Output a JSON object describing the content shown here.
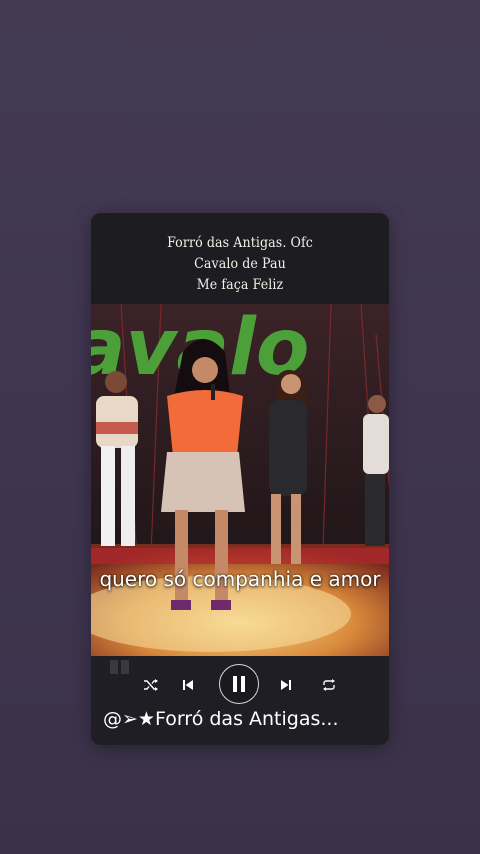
{
  "header": {
    "line1": "Forró das Antigas. Ofc",
    "line2": "Cavalo de Pau",
    "line3": "Me faça Feliz"
  },
  "video": {
    "caption": "quero só companhia e amor",
    "backdrop_logo_text": "avalo"
  },
  "player": {
    "track_title": "@➢★Forró das Antigas...",
    "icons": {
      "shuffle": "shuffle-icon",
      "previous": "skip-previous-icon",
      "play_pause": "pause-icon",
      "next": "skip-next-icon",
      "repeat": "repeat-icon"
    },
    "state": "playing"
  },
  "colors": {
    "background": "#413850",
    "card": "#1c1b20",
    "text": "#ffffff",
    "stage_green": "#4fae3c"
  }
}
